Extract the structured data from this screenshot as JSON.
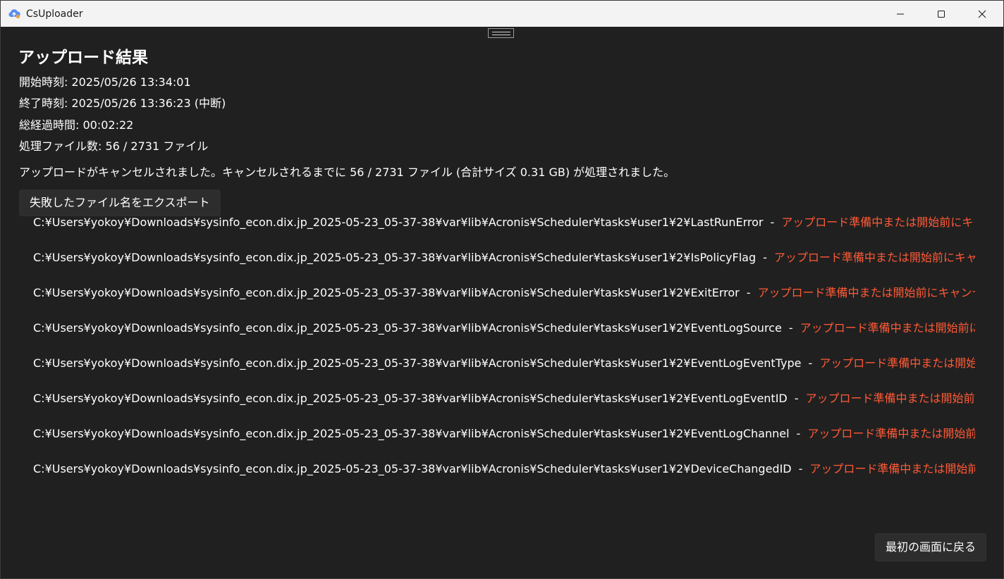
{
  "window": {
    "title": "CsUploader",
    "icon": "cloud-upload-icon"
  },
  "result": {
    "heading": "アップロード結果",
    "start_time": "開始時刻: 2025/05/26 13:34:01",
    "end_time": "終了時刻: 2025/05/26 13:36:23 (中断)",
    "elapsed": "総経過時間: 00:02:22",
    "processed": "処理ファイル数: 56 / 2731  ファイル",
    "message": "アップロードがキャンセルされました。キャンセルされるまでに 56 / 2731 ファイル (合計サイズ 0.31 GB) が処理されました。"
  },
  "export_button_label": "失敗したファイル名をエクスポート",
  "failed_files": [
    {
      "path": "C:¥Users¥yokoy¥Downloads¥sysinfo_econ.dix.jp_2025-05-23_05-37-38¥var¥lib¥Acronis¥Scheduler¥tasks¥user1¥2¥LastRunError",
      "sep": "-",
      "status": "アップロード準備中または開始前にキャンセルされました"
    },
    {
      "path": "C:¥Users¥yokoy¥Downloads¥sysinfo_econ.dix.jp_2025-05-23_05-37-38¥var¥lib¥Acronis¥Scheduler¥tasks¥user1¥2¥IsPolicyFlag",
      "sep": "-",
      "status": "アップロード準備中または開始前にキャンセルされました"
    },
    {
      "path": "C:¥Users¥yokoy¥Downloads¥sysinfo_econ.dix.jp_2025-05-23_05-37-38¥var¥lib¥Acronis¥Scheduler¥tasks¥user1¥2¥ExitError",
      "sep": "-",
      "status": "アップロード準備中または開始前にキャンセルされました"
    },
    {
      "path": "C:¥Users¥yokoy¥Downloads¥sysinfo_econ.dix.jp_2025-05-23_05-37-38¥var¥lib¥Acronis¥Scheduler¥tasks¥user1¥2¥EventLogSource",
      "sep": "-",
      "status": "アップロード準備中または開始前にキャンセルされました"
    },
    {
      "path": "C:¥Users¥yokoy¥Downloads¥sysinfo_econ.dix.jp_2025-05-23_05-37-38¥var¥lib¥Acronis¥Scheduler¥tasks¥user1¥2¥EventLogEventType",
      "sep": "-",
      "status": "アップロード準備中または開始前にキャンセルされました"
    },
    {
      "path": "C:¥Users¥yokoy¥Downloads¥sysinfo_econ.dix.jp_2025-05-23_05-37-38¥var¥lib¥Acronis¥Scheduler¥tasks¥user1¥2¥EventLogEventID",
      "sep": "-",
      "status": "アップロード準備中または開始前にキャンセルされました"
    },
    {
      "path": "C:¥Users¥yokoy¥Downloads¥sysinfo_econ.dix.jp_2025-05-23_05-37-38¥var¥lib¥Acronis¥Scheduler¥tasks¥user1¥2¥EventLogChannel",
      "sep": "-",
      "status": "アップロード準備中または開始前にキャンセルされました"
    },
    {
      "path": "C:¥Users¥yokoy¥Downloads¥sysinfo_econ.dix.jp_2025-05-23_05-37-38¥var¥lib¥Acronis¥Scheduler¥tasks¥user1¥2¥DeviceChangedID",
      "sep": "-",
      "status": "アップロード準備中または開始前にキャンセルされました"
    }
  ],
  "back_button_label": "最初の画面に戻る",
  "colors": {
    "background": "#202020",
    "titlebar": "#f3f3f3",
    "error_text": "#ff5a36",
    "button": "#2d2d2d"
  }
}
